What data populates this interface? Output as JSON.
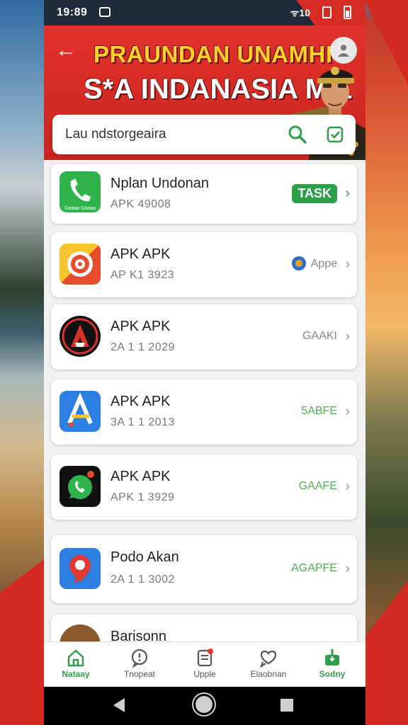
{
  "status": {
    "time": "19:89",
    "signal": "ᯤ10"
  },
  "banner": {
    "title_line1": "PRAUNDAN UNAMHI",
    "title_line2": "S*A INDANASIA M 1"
  },
  "search": {
    "text": "Lau ndstorgeaira"
  },
  "apps": [
    {
      "name": "Nplan Undonan",
      "sub": "APK 49008",
      "action": "TASK",
      "icon_label": "Gaaaa Gaaaa",
      "color": "#2fb34a"
    },
    {
      "name": "APK APK",
      "sub": "AP K1 3923",
      "action": "Appe",
      "color": "#f0a020"
    },
    {
      "name": "APK APK",
      "sub": "2A 1 1 2029",
      "action": "GAAKI",
      "color": "#111111"
    },
    {
      "name": "APK APK",
      "sub": "3A 1 1 2013",
      "action": "5ABFE",
      "color": "#2a7fe0"
    },
    {
      "name": "APK APK",
      "sub": "APK 1 3929",
      "action": "GAAFE",
      "color": "#111111"
    },
    {
      "name": "Podo Akan",
      "sub": "2A 1 1 3002",
      "action": "AGAPFE",
      "color": "#2a7fe0"
    },
    {
      "name": "Barisonn",
      "sub": "",
      "action": "",
      "color": "#8a5a2a"
    }
  ],
  "bottom_nav": [
    {
      "label": "Nataay",
      "icon": "home-icon"
    },
    {
      "label": "Tnopeat",
      "icon": "chat-alert-icon"
    },
    {
      "label": "Upple",
      "icon": "note-icon"
    },
    {
      "label": "Elaobnan",
      "icon": "heart-chat-icon"
    },
    {
      "label": "Sodny",
      "icon": "download-box-icon"
    }
  ]
}
